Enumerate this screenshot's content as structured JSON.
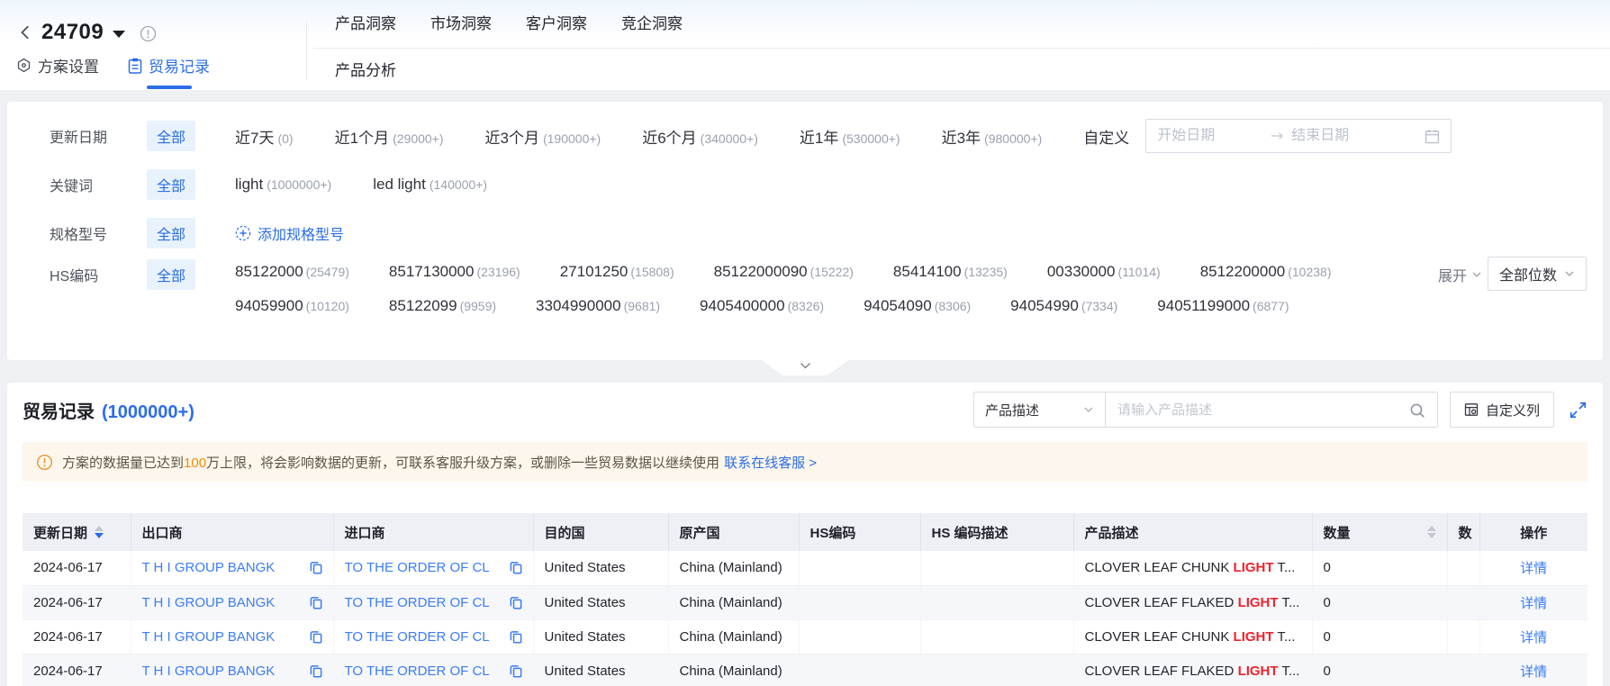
{
  "colors": {
    "accent": "#2b6de8",
    "highlight_red": "#f2222c",
    "warning_orange": "#f08c00",
    "banner_bg": "#fdf6ec",
    "chip_bg": "#e8f2fd"
  },
  "header": {
    "plan_id": "24709",
    "nav_tabs": [
      {
        "label": "产品洞察"
      },
      {
        "label": "市场洞察"
      },
      {
        "label": "客户洞察"
      },
      {
        "label": "竞企洞察"
      }
    ],
    "sub_nav_tab": "产品分析",
    "left_tabs": [
      {
        "label": "方案设置"
      },
      {
        "label": "贸易记录"
      }
    ]
  },
  "filters": {
    "update_date": {
      "label": "更新日期",
      "all": "全部",
      "options": [
        {
          "name": "近7天",
          "count": "(0)"
        },
        {
          "name": "近1个月",
          "count": "(29000+)"
        },
        {
          "name": "近3个月",
          "count": "(190000+)"
        },
        {
          "name": "近6个月",
          "count": "(340000+)"
        },
        {
          "name": "近1年",
          "count": "(530000+)"
        },
        {
          "name": "近3年",
          "count": "(980000+)"
        }
      ],
      "custom_label": "自定义",
      "start_placeholder": "开始日期",
      "end_placeholder": "结束日期"
    },
    "keyword": {
      "label": "关键词",
      "all": "全部",
      "options": [
        {
          "name": "light",
          "count": "(1000000+)"
        },
        {
          "name": "led light",
          "count": "(140000+)"
        }
      ]
    },
    "spec": {
      "label": "规格型号",
      "all": "全部",
      "add_label": "添加规格型号"
    },
    "hs_code": {
      "label": "HS编码",
      "all": "全部",
      "row1": [
        {
          "code": "85122000",
          "count": "(25479)"
        },
        {
          "code": "8517130000",
          "count": "(23196)"
        },
        {
          "code": "27101250",
          "count": "(15808)"
        },
        {
          "code": "85122000090",
          "count": "(15222)"
        },
        {
          "code": "85414100",
          "count": "(13235)"
        },
        {
          "code": "00330000",
          "count": "(11014)"
        },
        {
          "code": "8512200000",
          "count": "(10238)"
        }
      ],
      "row2": [
        {
          "code": "94059900",
          "count": "(10120)"
        },
        {
          "code": "85122099",
          "count": "(9959)"
        },
        {
          "code": "3304990000",
          "count": "(9681)"
        },
        {
          "code": "9405400000",
          "count": "(8326)"
        },
        {
          "code": "94054090",
          "count": "(8306)"
        },
        {
          "code": "94054990",
          "count": "(7334)"
        },
        {
          "code": "94051199000",
          "count": "(6877)"
        }
      ],
      "expand_label": "展开",
      "digits_select": "全部位数"
    }
  },
  "records": {
    "title": "贸易记录",
    "count": "(1000000+)",
    "search": {
      "field": "产品描述",
      "placeholder": "请输入产品描述"
    },
    "customize_label": "自定义列",
    "banner": {
      "text_pre": "方案的数据量已达到",
      "highlight": "100",
      "text_post": "万上限，将会影响数据的更新，可联系客服升级方案，或删除一些贸易数据以继续使用",
      "link": "联系在线客服 >"
    },
    "table": {
      "columns": {
        "date": "更新日期",
        "exporter": "出口商",
        "importer": "进口商",
        "dest": "目的国",
        "origin": "原产国",
        "hs": "HS编码",
        "hs_desc": "HS 编码描述",
        "product": "产品描述",
        "qty": "数量",
        "qty2": "数",
        "action": "操作"
      },
      "rows": [
        {
          "date": "2024-06-17",
          "exporter": "T H I GROUP BANGK",
          "importer": "TO THE ORDER OF CL",
          "dest": "United States",
          "origin": "China (Mainland)",
          "product_pre": "CLOVER LEAF CHUNK ",
          "product_hl": "LIGHT",
          "product_post": " T...",
          "qty": "0",
          "action": "详情"
        },
        {
          "date": "2024-06-17",
          "exporter": "T H I GROUP BANGK",
          "importer": "TO THE ORDER OF CL",
          "dest": "United States",
          "origin": "China (Mainland)",
          "product_pre": "CLOVER LEAF FLAKED ",
          "product_hl": "LIGHT",
          "product_post": " T...",
          "qty": "0",
          "action": "详情"
        },
        {
          "date": "2024-06-17",
          "exporter": "T H I GROUP BANGK",
          "importer": "TO THE ORDER OF CL",
          "dest": "United States",
          "origin": "China (Mainland)",
          "product_pre": "CLOVER LEAF CHUNK ",
          "product_hl": "LIGHT",
          "product_post": " T...",
          "qty": "0",
          "action": "详情"
        },
        {
          "date": "2024-06-17",
          "exporter": "T H I GROUP BANGK",
          "importer": "TO THE ORDER OF CL",
          "dest": "United States",
          "origin": "China (Mainland)",
          "product_pre": "CLOVER LEAF FLAKED ",
          "product_hl": "LIGHT",
          "product_post": " T...",
          "qty": "0",
          "action": "详情"
        }
      ]
    }
  }
}
